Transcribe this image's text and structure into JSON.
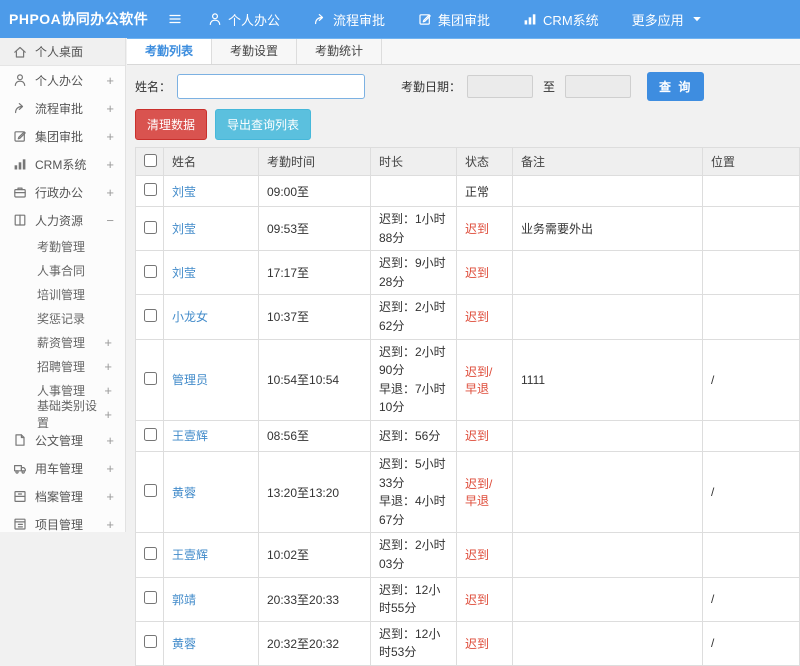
{
  "brand": "PHPOA协同办公软件",
  "topnav": {
    "items": [
      {
        "key": "personal-office",
        "label": "个人办公",
        "icon": "user-icon"
      },
      {
        "key": "process-approval",
        "label": "流程审批",
        "icon": "share-icon"
      },
      {
        "key": "group-approval",
        "label": "集团审批",
        "icon": "edit-icon"
      },
      {
        "key": "crm",
        "label": "CRM系统",
        "icon": "chart-icon"
      },
      {
        "key": "more-apps",
        "label": "更多应用",
        "icon": "",
        "caret": true
      }
    ]
  },
  "sidebar": {
    "items": [
      {
        "key": "personal-desktop",
        "label": "个人桌面",
        "icon": "home-icon",
        "expand": "",
        "active": true
      },
      {
        "key": "personal-office",
        "label": "个人办公",
        "icon": "user-icon",
        "expand": "+"
      },
      {
        "key": "process-approval",
        "label": "流程审批",
        "icon": "share-icon",
        "expand": "+"
      },
      {
        "key": "group-approval",
        "label": "集团审批",
        "icon": "edit-icon",
        "expand": "+"
      },
      {
        "key": "crm",
        "label": "CRM系统",
        "icon": "chart-icon",
        "expand": "+"
      },
      {
        "key": "admin-office",
        "label": "行政办公",
        "icon": "briefcase-icon",
        "expand": "+"
      },
      {
        "key": "hr",
        "label": "人力资源",
        "icon": "book-icon",
        "expand": "−",
        "children": [
          {
            "key": "attendance-mgmt",
            "label": "考勤管理",
            "expand": ""
          },
          {
            "key": "hr-contract",
            "label": "人事合同",
            "expand": ""
          },
          {
            "key": "training-mgmt",
            "label": "培训管理",
            "expand": ""
          },
          {
            "key": "reward-punish",
            "label": "奖惩记录",
            "expand": ""
          },
          {
            "key": "salary-mgmt",
            "label": "薪资管理",
            "expand": "+"
          },
          {
            "key": "recruit-mgmt",
            "label": "招聘管理",
            "expand": "+"
          },
          {
            "key": "personnel-mgmt",
            "label": "人事管理",
            "expand": "+"
          },
          {
            "key": "base-category-settings",
            "label": "基础类别设置",
            "expand": "+"
          }
        ]
      },
      {
        "key": "document-mgmt",
        "label": "公文管理",
        "icon": "doc-icon",
        "expand": "+"
      },
      {
        "key": "vehicle-mgmt",
        "label": "用车管理",
        "icon": "truck-icon",
        "expand": "+"
      },
      {
        "key": "archive-mgmt",
        "label": "档案管理",
        "icon": "archive-icon",
        "expand": "+"
      },
      {
        "key": "project-mgmt",
        "label": "项目管理",
        "icon": "project-icon",
        "expand": "+"
      }
    ]
  },
  "tabs": [
    {
      "key": "attendance-list",
      "label": "考勤列表",
      "active": true
    },
    {
      "key": "attendance-settings",
      "label": "考勤设置",
      "active": false
    },
    {
      "key": "attendance-stats",
      "label": "考勤统计",
      "active": false
    }
  ],
  "filter": {
    "name_label": "姓名：",
    "name_value": "",
    "date_label": "考勤日期：",
    "date_from": "",
    "to_label": "至",
    "date_to": "",
    "query_button": "查 询"
  },
  "actions": {
    "clean_button": "清理数据",
    "export_button": "导出查询列表"
  },
  "table": {
    "headers": [
      "姓名",
      "考勤时间",
      "时长",
      "状态",
      "备注",
      "位置"
    ],
    "rows": [
      {
        "name": "刘莹",
        "time": "09:00至",
        "duration": "",
        "status": "正常",
        "status_type": "normal",
        "remark": "",
        "location": ""
      },
      {
        "name": "刘莹",
        "time": "09:53至",
        "duration": "迟到：1小时88分",
        "status": "迟到",
        "status_type": "late",
        "remark": "业务需要外出",
        "location": ""
      },
      {
        "name": "刘莹",
        "time": "17:17至",
        "duration": "迟到：9小时28分",
        "status": "迟到",
        "status_type": "late",
        "remark": "",
        "location": ""
      },
      {
        "name": "小龙女",
        "time": "10:37至",
        "duration": "迟到：2小时62分",
        "status": "迟到",
        "status_type": "late",
        "remark": "",
        "location": ""
      },
      {
        "name": "管理员",
        "time": "10:54至10:54",
        "duration": "迟到：2小时90分\n早退：7小时10分",
        "status": "迟到/早退",
        "status_type": "late",
        "remark": "1111",
        "location": "/"
      },
      {
        "name": "王壹辉",
        "time": "08:56至",
        "duration": "迟到：56分",
        "status": "迟到",
        "status_type": "late",
        "remark": "",
        "location": ""
      },
      {
        "name": "黄蓉",
        "time": "13:20至13:20",
        "duration": "迟到：5小时33分\n早退：4小时67分",
        "status": "迟到/早退",
        "status_type": "late",
        "remark": "",
        "location": "/"
      },
      {
        "name": "王壹辉",
        "time": "10:02至",
        "duration": "迟到：2小时03分",
        "status": "迟到",
        "status_type": "late",
        "remark": "",
        "location": ""
      },
      {
        "name": "郭靖",
        "time": "20:33至20:33",
        "duration": "迟到：12小时55分",
        "status": "迟到",
        "status_type": "late",
        "remark": "",
        "location": "/"
      },
      {
        "name": "黄蓉",
        "time": "20:32至20:32",
        "duration": "迟到：12小时53分",
        "status": "迟到",
        "status_type": "late",
        "remark": "",
        "location": "/"
      }
    ]
  },
  "colors": {
    "topbar_blue": "#4D9BE9",
    "accent_blue": "#3C8DDE",
    "link_blue": "#428BCA",
    "danger_red": "#D9534F",
    "info_cyan": "#5BC0DE",
    "late_red": "#DE4B39"
  }
}
